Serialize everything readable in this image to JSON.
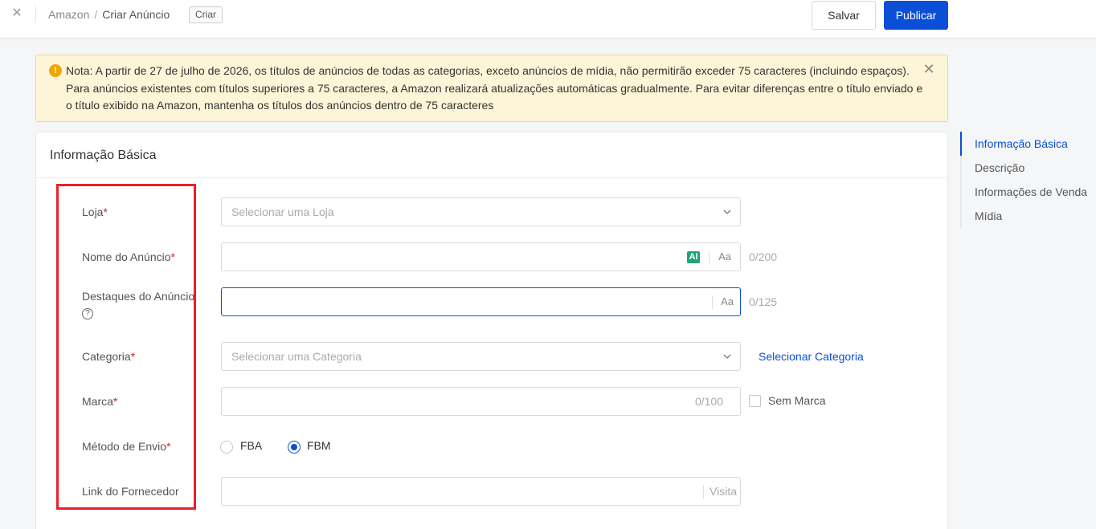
{
  "header": {
    "close_icon": "close-icon",
    "breadcrumb": {
      "root": "Amazon",
      "separator": "/",
      "current": "Criar Anúncio"
    },
    "tag": "Criar",
    "save_label": "Salvar",
    "publish_label": "Publicar"
  },
  "notice": {
    "icon": "warning-icon",
    "icon_glyph": "!",
    "text": "Nota: A partir de 27 de julho de 2026, os títulos de anúncios de todas as categorias, exceto anúncios de mídia, não permitirão exceder 75 caracteres (incluindo espaços). Para anúncios existentes com títulos superiores a 75 caracteres, a Amazon realizará atualizações automáticas gradualmente. Para evitar diferenças entre o título enviado e o título exibido na Amazon, mantenha os títulos dos anúncios dentro de 75 caracteres"
  },
  "section": {
    "title": "Informação Básica",
    "fields": {
      "loja": {
        "label": "Loja",
        "required_mark": "*",
        "placeholder": "Selecionar uma Loja"
      },
      "nome": {
        "label": "Nome do Anúncio",
        "required_mark": "*",
        "ai_badge": "AI",
        "case_toggle": "Aa",
        "counter": "0/200",
        "value": ""
      },
      "destaques": {
        "label": "Destaques do Anúncio",
        "help_glyph": "?",
        "case_toggle": "Aa",
        "counter": "0/125",
        "value": ""
      },
      "categoria": {
        "label": "Categoria",
        "required_mark": "*",
        "placeholder": "Selecionar uma Categoria",
        "link": "Selecionar Categoria"
      },
      "marca": {
        "label": "Marca",
        "required_mark": "*",
        "counter": "0/100",
        "checkbox_label": "Sem Marca",
        "checkbox_checked": false
      },
      "envio": {
        "label": "Método de Envio",
        "required_mark": "*",
        "options": [
          "FBA",
          "FBM"
        ],
        "selected": "FBM"
      },
      "fornecedor": {
        "label": "Link do Fornecedor",
        "action": "Visita",
        "value": ""
      }
    }
  },
  "side_nav": {
    "items": [
      "Informação Básica",
      "Descrição",
      "Informações de Venda",
      "Mídia"
    ],
    "active": "Informação Básica"
  },
  "colors": {
    "primary": "#0b4fd6",
    "notice_bg": "#fdf5d7",
    "required": "#e02020",
    "highlight": "#e8202a",
    "ai_badge": "#1fa37a"
  }
}
